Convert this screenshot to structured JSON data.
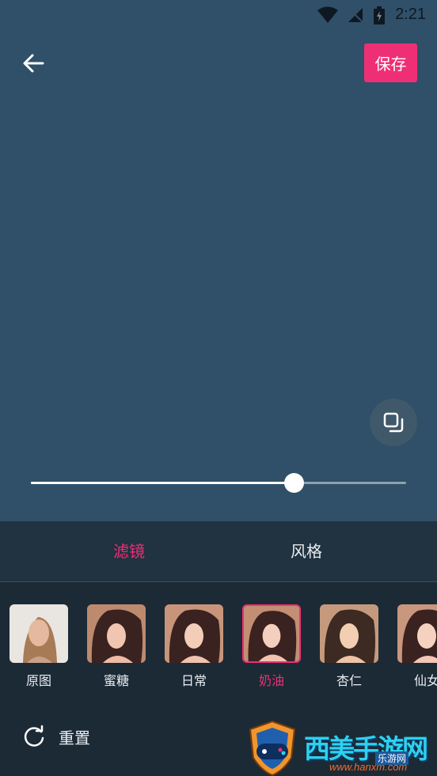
{
  "status_bar": {
    "time": "2:21",
    "icons": [
      "wifi-icon",
      "no-signal-icon",
      "battery-charging-icon"
    ]
  },
  "header": {
    "back_icon": "arrow-left-icon",
    "save_label": "保存",
    "accent_color": "#ef2f75"
  },
  "canvas": {
    "compare_icon": "compare-layers-icon",
    "intensity": 0.7
  },
  "tabs": [
    {
      "label": "滤镜",
      "selected": true
    },
    {
      "label": "风格",
      "selected": false
    }
  ],
  "filters": [
    {
      "label": "原图",
      "selected": false
    },
    {
      "label": "蜜糖",
      "selected": false
    },
    {
      "label": "日常",
      "selected": false
    },
    {
      "label": "奶油",
      "selected": true
    },
    {
      "label": "杏仁",
      "selected": false
    },
    {
      "label": "仙女",
      "selected": false
    }
  ],
  "footer": {
    "reset_label": "重置",
    "reset_icon": "refresh-icon"
  },
  "watermark": {
    "title": "西美手游网",
    "subtitle": "乐游网",
    "url": "www.hanxm.com"
  }
}
